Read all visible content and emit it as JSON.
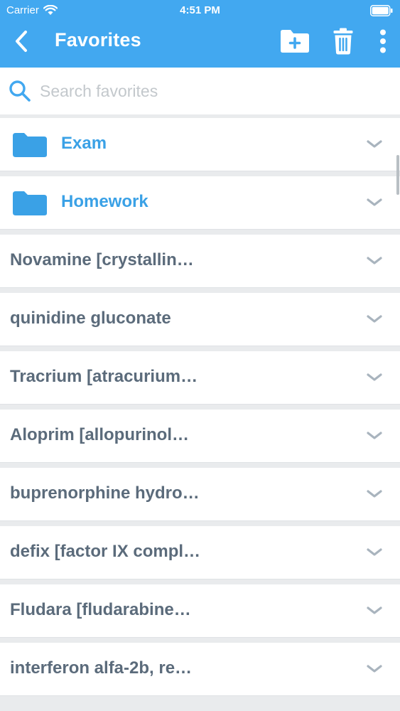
{
  "status_bar": {
    "carrier": "Carrier",
    "time": "4:51 PM"
  },
  "nav": {
    "title": "Favorites",
    "icons": {
      "back": "chevron-left-icon",
      "new_folder": "folder-plus-icon",
      "delete": "trash-icon",
      "more": "more-vertical-icon"
    }
  },
  "search": {
    "placeholder": "Search favorites",
    "value": ""
  },
  "folders": [
    {
      "label": "Exam"
    },
    {
      "label": "Homework"
    }
  ],
  "favorites": [
    {
      "label": "Novamine [crystallin…"
    },
    {
      "label": "quinidine gluconate"
    },
    {
      "label": "Tracrium [atracurium…"
    },
    {
      "label": "Aloprim [allopurinol…"
    },
    {
      "label": "buprenorphine hydro…"
    },
    {
      "label": "defix [factor IX compl…"
    },
    {
      "label": "Fludara [fludarabine…"
    },
    {
      "label": "interferon alfa-2b, re…"
    }
  ],
  "colors": {
    "header": "#42a8f0",
    "folder": "#3aa1e6",
    "item_text": "#5b6b7b",
    "chevron": "#a9b4be",
    "background": "#e9ebed"
  }
}
